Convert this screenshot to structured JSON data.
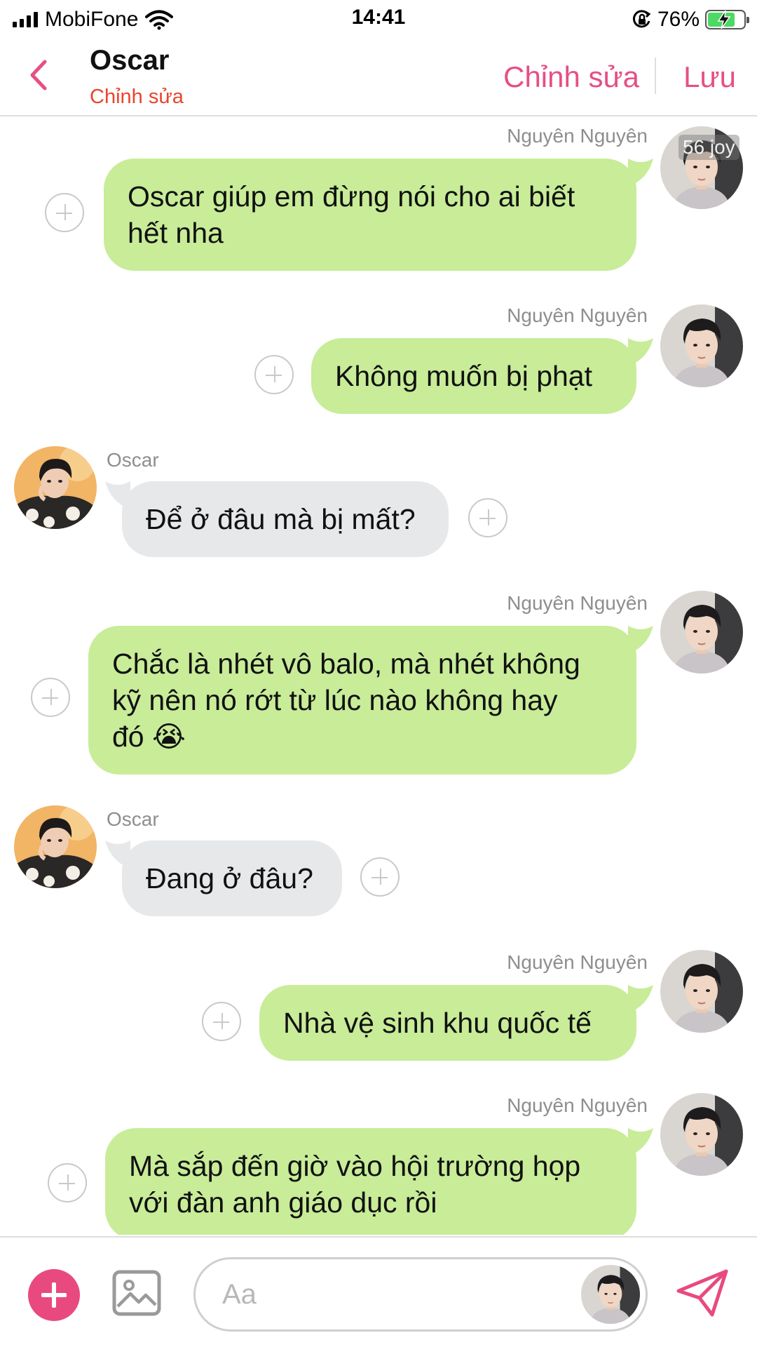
{
  "status_bar": {
    "carrier": "MobiFone",
    "time": "14:41",
    "battery_percent": "76%",
    "battery_level": 0.76,
    "icons": [
      "signal-icon",
      "wifi-icon",
      "orientation-lock-icon",
      "battery-charging-icon"
    ]
  },
  "header": {
    "contact_name": "Oscar",
    "subtitle": "Chỉnh sửa",
    "edit_label": "Chỉnh sửa",
    "save_label": "Lưu",
    "accent_color": "#e64f86",
    "subtitle_color": "#e8452d"
  },
  "chat": {
    "watermark": "56 joy",
    "messages": [
      {
        "sender": "Nguyên Nguyên",
        "side": "right",
        "lines": [
          "Oscar giúp em đừng nói cho ai biết",
          "hết nha"
        ]
      },
      {
        "sender": "Nguyên Nguyên",
        "side": "right",
        "lines": [
          "Không muốn bị phạt"
        ]
      },
      {
        "sender": "Oscar",
        "side": "left",
        "lines": [
          "Để ở đâu mà bị mất?"
        ]
      },
      {
        "sender": "Nguyên Nguyên",
        "side": "right",
        "lines": [
          "Chắc là nhét vô balo, mà nhét không",
          "kỹ nên nó rớt từ lúc nào không hay",
          "đó 😭"
        ]
      },
      {
        "sender": "Oscar",
        "side": "left",
        "lines": [
          "Đang ở đâu?"
        ]
      },
      {
        "sender": "Nguyên Nguyên",
        "side": "right",
        "lines": [
          "Nhà vệ sinh khu quốc tế"
        ]
      },
      {
        "sender": "Nguyên Nguyên",
        "side": "right",
        "lines": [
          "Mà sắp đến giờ vào hội trường họp",
          "với đàn anh giáo dục rồi"
        ]
      }
    ],
    "colors": {
      "my_bubble": "#c8ec98",
      "their_bubble": "#e7e8ea",
      "name_label": "#8e8e8e"
    }
  },
  "composer": {
    "placeholder": "Aa",
    "icons": [
      "plus-icon",
      "image-icon",
      "send-icon"
    ],
    "accent_color": "#e84a7f"
  }
}
